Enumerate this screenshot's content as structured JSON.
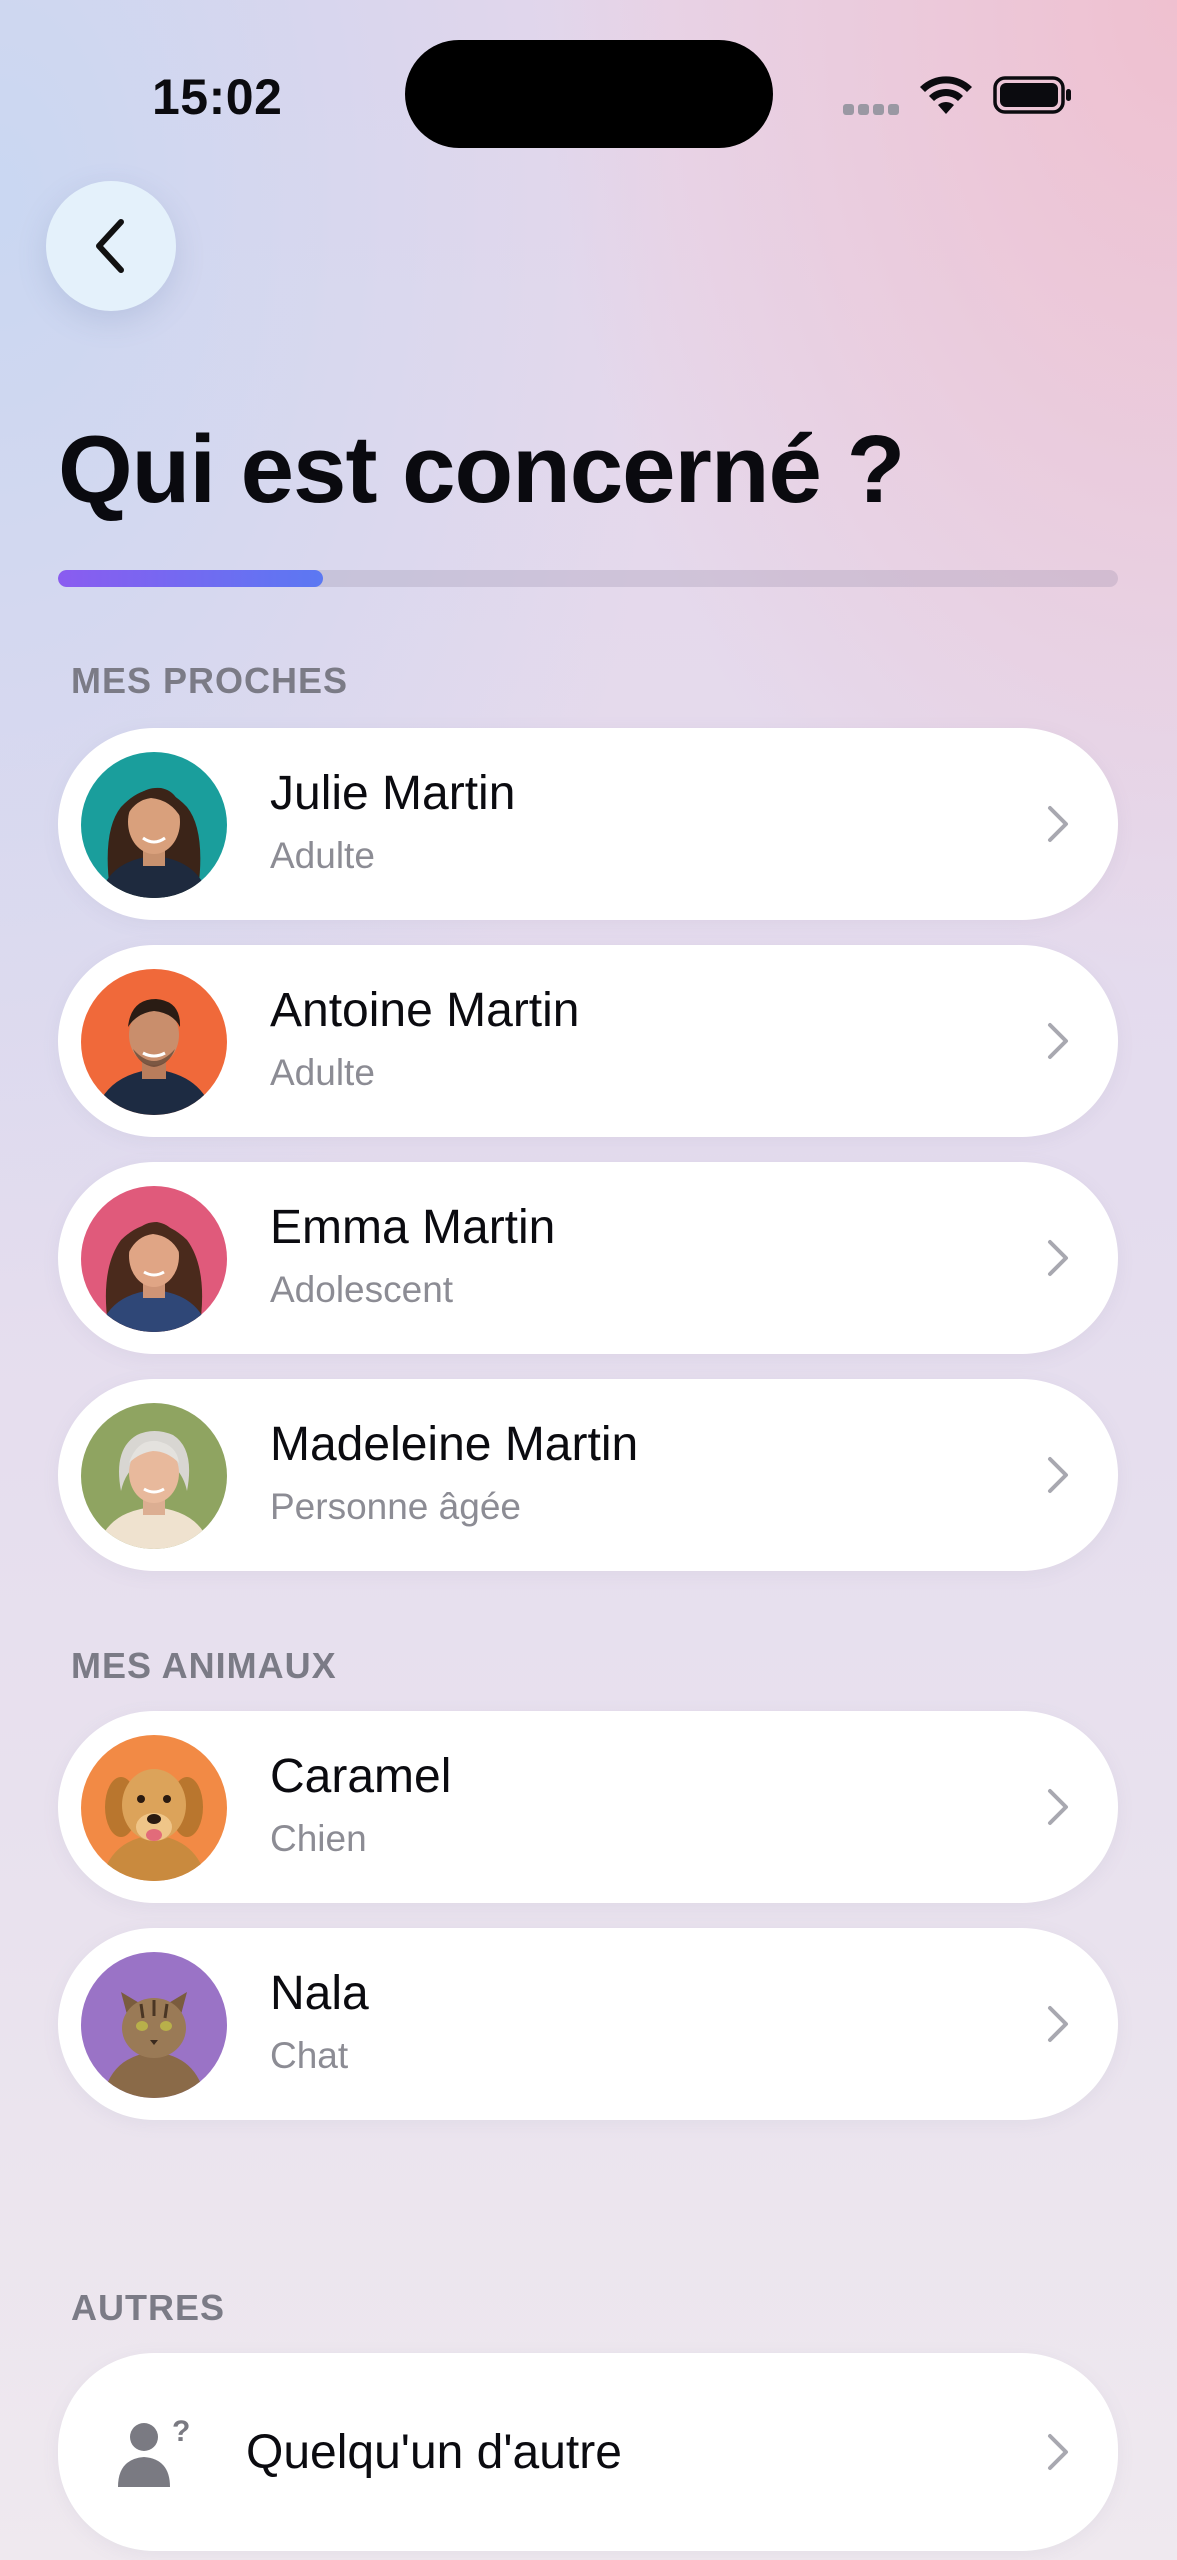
{
  "status_bar": {
    "time": "15:02"
  },
  "page": {
    "title": "Qui est concerné ?",
    "progress": 0.25
  },
  "sections": {
    "proches": {
      "label": "MES PROCHES",
      "items": [
        {
          "name": "Julie Martin",
          "subtitle": "Adulte",
          "avatar_bg": "#1a9e9c"
        },
        {
          "name": "Antoine Martin",
          "subtitle": "Adulte",
          "avatar_bg": "#f0693a"
        },
        {
          "name": "Emma Martin",
          "subtitle": "Adolescent",
          "avatar_bg": "#e05a7b"
        },
        {
          "name": "Madeleine Martin",
          "subtitle": "Personne âgée",
          "avatar_bg": "#8fa461"
        }
      ]
    },
    "animaux": {
      "label": "MES ANIMAUX",
      "items": [
        {
          "name": "Caramel",
          "subtitle": "Chien",
          "avatar_bg": "#f28a45"
        },
        {
          "name": "Nala",
          "subtitle": "Chat",
          "avatar_bg": "#9a73c6"
        }
      ]
    },
    "autres": {
      "label": "AUTRES",
      "items": [
        {
          "name": "Quelqu'un d'autre",
          "icon": "person-question-icon"
        }
      ]
    }
  },
  "colors": {
    "progress_start": "#8a5cf0",
    "progress_end": "#5b78f2",
    "back_button_bg": "#e4f1fb"
  }
}
